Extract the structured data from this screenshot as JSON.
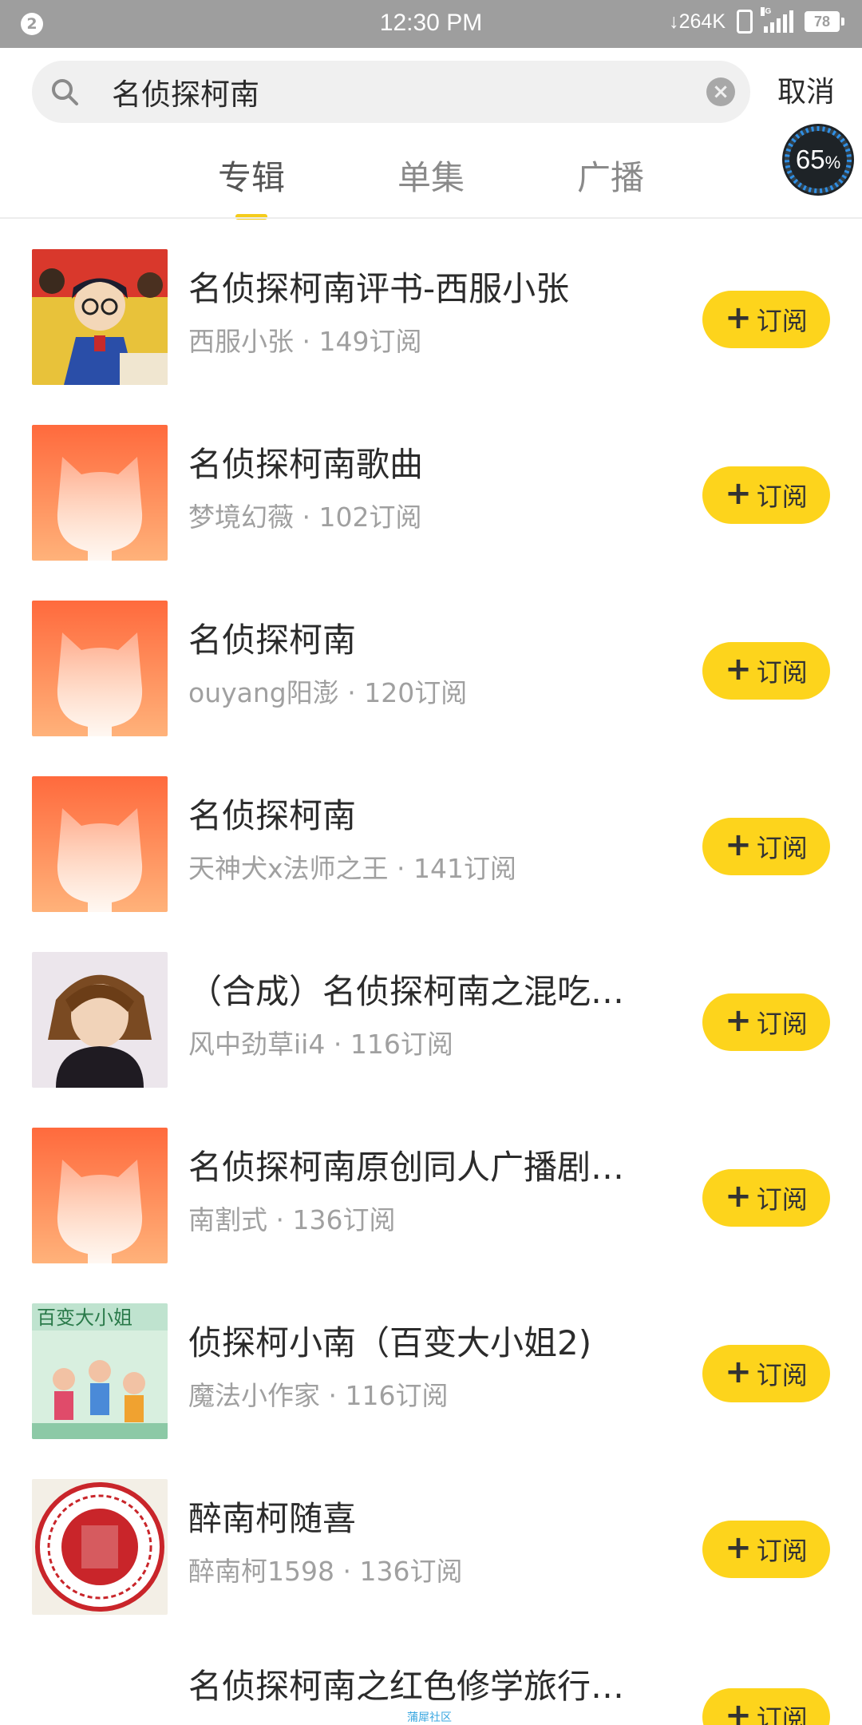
{
  "status_bar": {
    "notification_count": "2",
    "time": "12:30 PM",
    "net_speed": "264K",
    "network_type": "4G",
    "battery": "78"
  },
  "search": {
    "query": "名侦探柯南",
    "placeholder": "",
    "cancel_label": "取消"
  },
  "tabs": [
    {
      "label": "专辑",
      "active": true
    },
    {
      "label": "单集",
      "active": false
    },
    {
      "label": "广播",
      "active": false
    }
  ],
  "progress_badge": {
    "value": "65",
    "unit": "%"
  },
  "results": [
    {
      "title": "名侦探柯南评书-西服小张",
      "author": "西服小张",
      "subs": "149订阅",
      "cover": "anime-cover"
    },
    {
      "title": "名侦探柯南歌曲",
      "author": "梦境幻薇",
      "subs": "102订阅",
      "cover": "default-cat-cover"
    },
    {
      "title": "名侦探柯南",
      "author": "ouyang阳澎",
      "subs": "120订阅",
      "cover": "default-cat-cover"
    },
    {
      "title": "名侦探柯南",
      "author": "天神犬x法师之王",
      "subs": "141订阅",
      "cover": "default-cat-cover"
    },
    {
      "title": "（合成）名侦探柯南之混吃…",
      "author": "风中劲草ii4",
      "subs": "116订阅",
      "cover": "character-cover"
    },
    {
      "title": "名侦探柯南原创同人广播剧…",
      "author": "南割式",
      "subs": "136订阅",
      "cover": "default-cat-cover"
    },
    {
      "title": "侦探柯小南（百变大小姐2)",
      "author": "魔法小作家",
      "subs": "116订阅",
      "cover": "book-cover"
    },
    {
      "title": "醉南柯随喜",
      "author": "醉南柯1598",
      "subs": "136订阅",
      "cover": "seal-cover"
    },
    {
      "title": "名侦探柯南之红色修学旅行…",
      "author": "",
      "subs": "",
      "cover": "none"
    }
  ],
  "subscribe_label": "订阅",
  "meta_separator": " · ",
  "footer": {
    "community_label": "蒲犀社区"
  },
  "colors": {
    "accent": "#fdd41c",
    "status_bar": "#9e9e9e",
    "cover_gradient_top": "#ff6a3d",
    "cover_gradient_bottom": "#ffb27a"
  }
}
